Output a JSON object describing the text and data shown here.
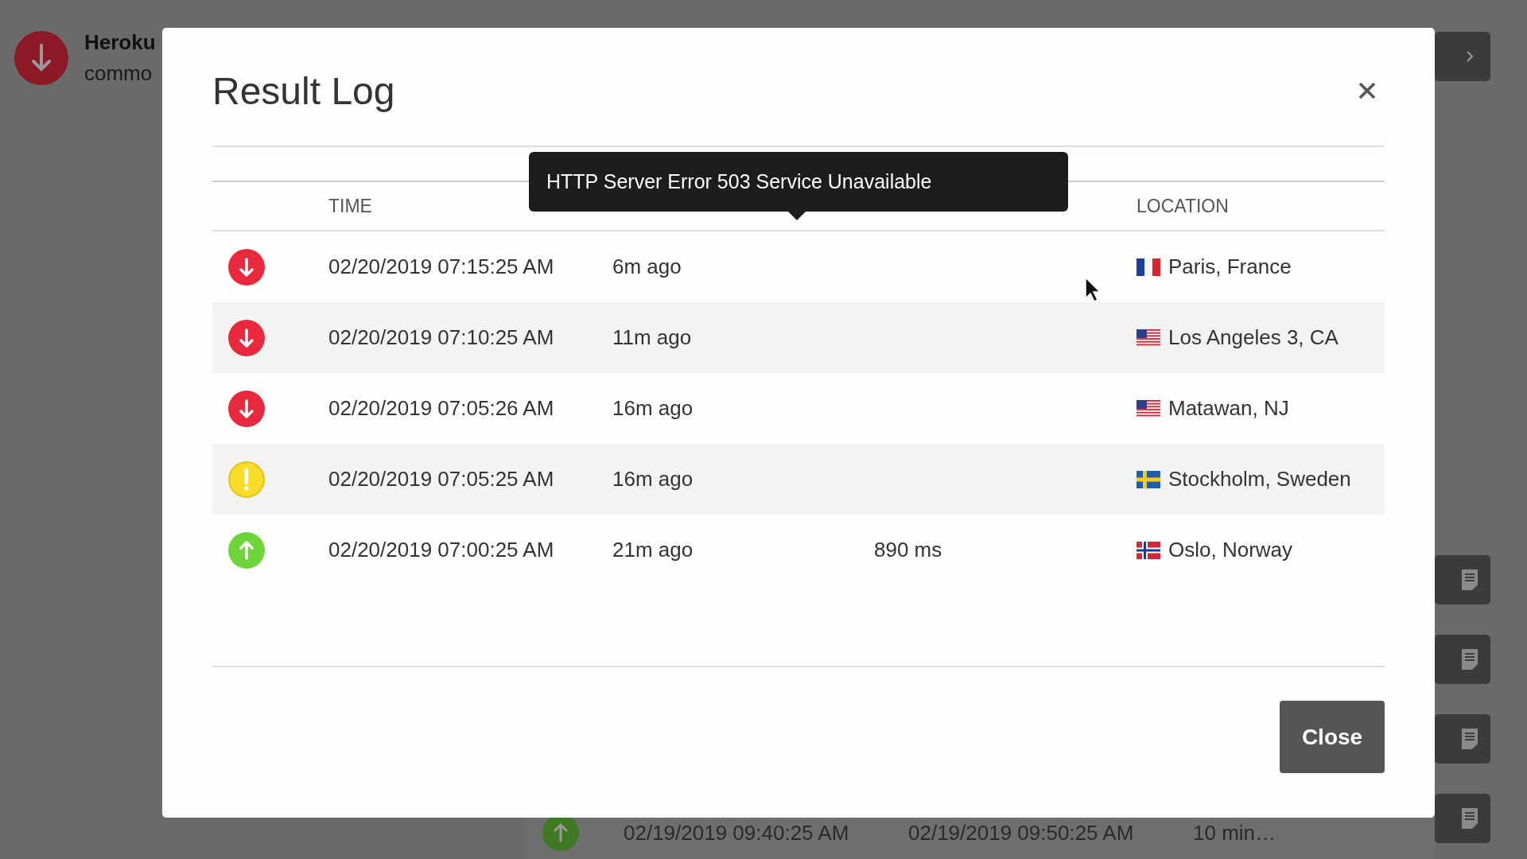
{
  "background": {
    "monitor": {
      "kind": "down",
      "name": "Heroku",
      "subtitle": "commo"
    },
    "history_row": {
      "kind": "up",
      "start": "02/19/2019 09:40:25 AM",
      "end": "02/19/2019 09:50:25 AM",
      "duration": "10 min…"
    }
  },
  "dialog": {
    "title": "Result Log",
    "columns": {
      "time": "TIME",
      "location": "LOCATION"
    },
    "tooltip": "HTTP Server Error 503 Service Unavailable",
    "rows": [
      {
        "kind": "down",
        "time": "02/20/2019 07:15:25 AM",
        "ago": "6m ago",
        "flag": {
          "kind": "fr"
        },
        "location": "Paris, France"
      },
      {
        "kind": "down",
        "time": "02/20/2019 07:10:25 AM",
        "ago": "11m ago",
        "flag": {
          "kind": "us"
        },
        "location": "Los Angeles 3, CA"
      },
      {
        "kind": "down",
        "time": "02/20/2019 07:05:26 AM",
        "ago": "16m ago",
        "flag": {
          "kind": "us"
        },
        "location": "Matawan, NJ"
      },
      {
        "kind": "warning",
        "time": "02/20/2019 07:05:25 AM",
        "ago": "16m ago",
        "flag": {
          "kind": "se"
        },
        "location": "Stockholm, Sweden"
      },
      {
        "kind": "up",
        "time": "02/20/2019 07:00:25 AM",
        "ago": "21m ago",
        "response": "890 ms",
        "flag": {
          "kind": "no"
        },
        "location": "Oslo, Norway"
      }
    ],
    "close_button": "Close"
  }
}
